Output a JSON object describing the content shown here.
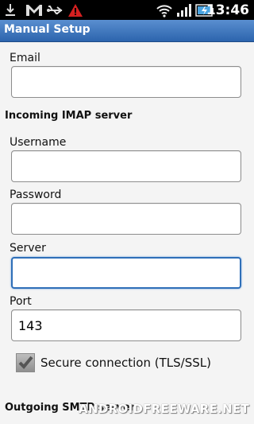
{
  "status_bar": {
    "time": "13:46",
    "icons": [
      "download-icon",
      "gmail-icon",
      "usb-icon",
      "warning-icon",
      "wifi-icon",
      "signal-icon",
      "battery-icon"
    ]
  },
  "title_bar": {
    "title": "Manual Setup"
  },
  "form": {
    "email": {
      "label": "Email",
      "value": ""
    },
    "incoming_section": "Incoming IMAP server",
    "username": {
      "label": "Username",
      "value": ""
    },
    "password": {
      "label": "Password",
      "value": ""
    },
    "server": {
      "label": "Server",
      "value": ""
    },
    "port": {
      "label": "Port",
      "value": "143"
    },
    "secure": {
      "label": "Secure connection (TLS/SSL)",
      "checked": true
    },
    "outgoing_section": "Outgoing SMTP server"
  },
  "watermark": "ANDROIDFREEWARE.NET",
  "colors": {
    "title_bar": "#2c64ad",
    "focus_border": "#2f6fb8",
    "background": "#f4f4f4"
  }
}
